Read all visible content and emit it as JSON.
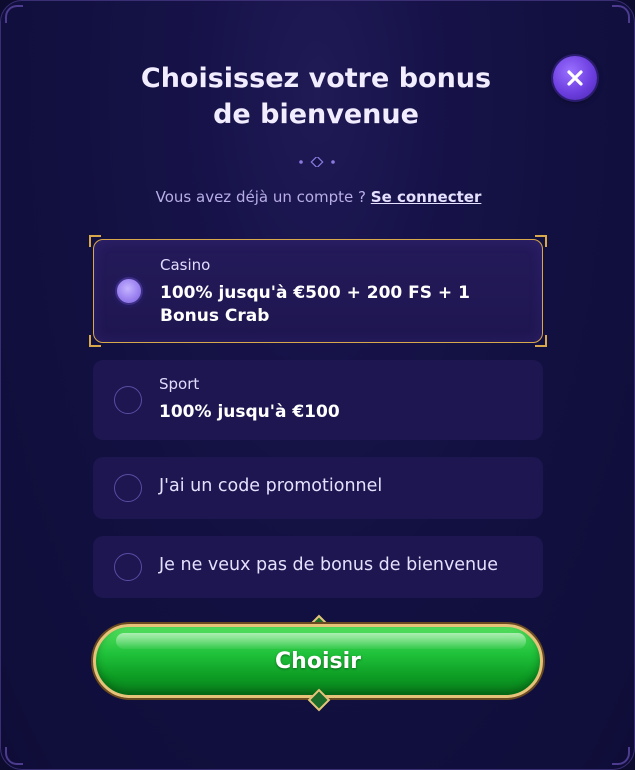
{
  "header": {
    "title_line1": "Choisissez votre bonus",
    "title_line2": "de bienvenue"
  },
  "login": {
    "prompt": "Vous avez déjà un compte ?",
    "link": "Se connecter"
  },
  "options": [
    {
      "label": "Casino",
      "value": "100% jusqu'à €500 + 200 FS + 1 Bonus Crab",
      "selected": true
    },
    {
      "label": "Sport",
      "value": "100% jusqu'à €100",
      "selected": false
    },
    {
      "text": "J'ai un code promotionnel",
      "selected": false
    },
    {
      "text": "Je ne veux pas de bonus de bienvenue",
      "selected": false
    }
  ],
  "cta": {
    "label": "Choisir"
  },
  "icons": {
    "close": "close-icon"
  },
  "colors": {
    "background": "#121040",
    "accent_purple": "#7b5cf0",
    "gold_border": "#d9a84a",
    "cta_green": "#1fc13a"
  }
}
